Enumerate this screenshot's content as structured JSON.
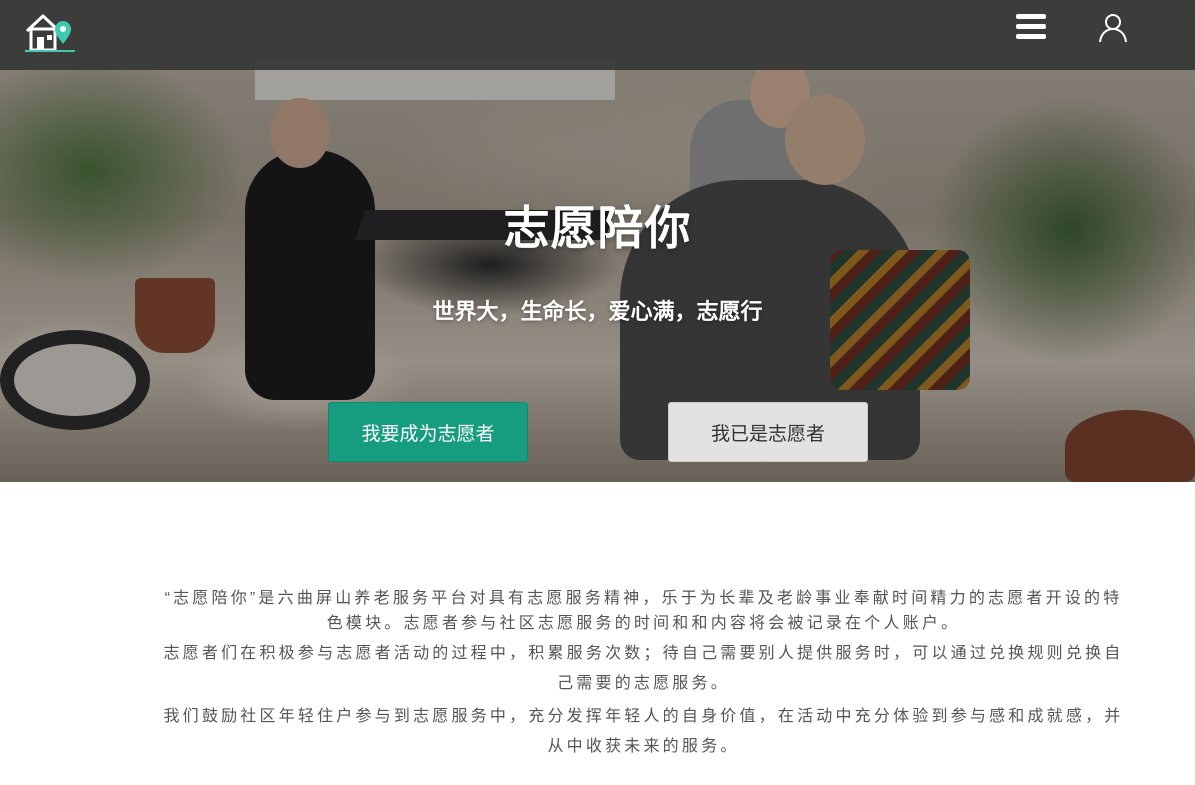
{
  "navbar": {
    "logo_icon": "house-location-pin-logo",
    "menu_icon": "hamburger-menu-icon",
    "user_icon": "user-account-icon"
  },
  "hero": {
    "title": "志愿陪你",
    "subtitle": "世界大，生命长，爱心满，志愿行",
    "primary_button": "我要成为志愿者",
    "secondary_button": "我已是志愿者"
  },
  "intro": {
    "paragraph_1": "“志愿陪你”是六曲屏山养老服务平台对具有志愿服务精神，乐于为长辈及老龄事业奉献时间精力的志愿者开设的特色模块。志愿者参与社区志愿服务的时间和和内容将会被记录在个人账户。",
    "paragraph_2": "志愿者们在积极参与志愿者活动的过程中，积累服务次数；待自己需要别人提供服务时，可以通过兑换规则兑换自己需要的志愿服务。",
    "paragraph_3": "我们鼓励社区年轻住户参与到志愿服务中，充分发挥年轻人的自身价值，在活动中充分体验到参与感和成就感，并从中收获未来的服务。"
  },
  "colors": {
    "navbar_bg": "#373737",
    "primary": "#169c7e",
    "secondary": "#e2e2e2",
    "logo_accent": "#3fc9b0"
  }
}
